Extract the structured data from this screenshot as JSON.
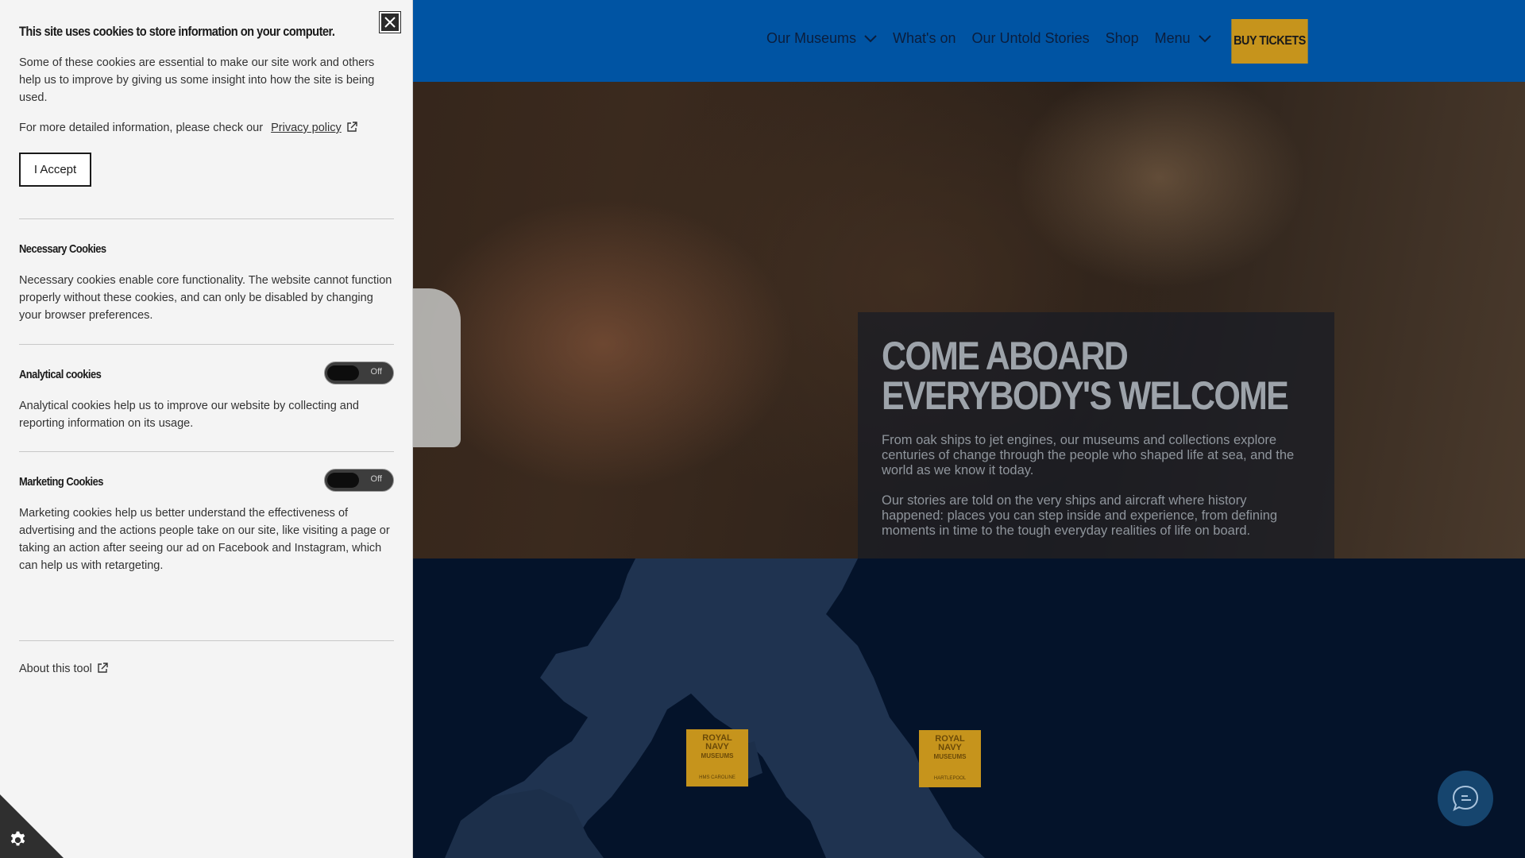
{
  "header": {
    "nav": [
      {
        "label": "Our Museums",
        "has_dropdown": true
      },
      {
        "label": "What's on",
        "has_dropdown": false
      },
      {
        "label": "Our Untold Stories",
        "has_dropdown": false
      },
      {
        "label": "Shop",
        "has_dropdown": false
      },
      {
        "label": "Menu",
        "has_dropdown": true
      }
    ],
    "buy_label": "BUY TICKETS",
    "colors": {
      "bar": "#0054a3",
      "button": "#c6941c"
    }
  },
  "hero": {
    "title": "COME ABOARD EVERYBODY'S WELCOME",
    "p1": "From oak ships to jet engines, our museums and collections explore centuries of change through the people who shaped life at sea, and the world as we know it today.",
    "p2": "Our stories are told on the very ships and aircraft where history happened: places you can step inside and experience, from defining moments in time to the tough everyday realities of life on board."
  },
  "map": {
    "pins": [
      {
        "logo_line1": "ROYAL",
        "logo_line2": "NAVY",
        "logo_line3": "MUSEUMS",
        "caption": "HMS CAROLINE"
      },
      {
        "logo_line1": "ROYAL",
        "logo_line2": "NAVY",
        "logo_line3": "MUSEUMS",
        "caption": "HARTLEPOOL"
      }
    ]
  },
  "cookie": {
    "title": "This site uses cookies to store information on your computer.",
    "intro": "Some of these cookies are essential to make our site work and others help us to improve by giving us some insight into how the site is being used.",
    "more_info": "For more detailed information, please check our",
    "privacy_link": "Privacy policy",
    "accept_label": "I Accept",
    "necessary": {
      "heading": "Necessary Cookies",
      "text": "Necessary cookies enable core functionality. The website cannot function properly without these cookies, and can only be disabled by changing your browser preferences."
    },
    "analytical": {
      "heading": "Analytical cookies",
      "toggle": "Off",
      "text": "Analytical cookies help us to improve our website by collecting and reporting information on its usage."
    },
    "marketing": {
      "heading": "Marketing Cookies",
      "toggle": "Off",
      "text": "Marketing cookies help us better understand the effectiveness of advertising and the actions people take on our site, like visiting a page or taking an action after seeing our ad on Facebook and Instagram, which can help us with retargeting."
    },
    "about_link": "About this tool",
    "icons": {
      "close": "close-icon",
      "external": "external-link-icon",
      "settings": "gear-icon",
      "chat": "chat-icon"
    }
  }
}
